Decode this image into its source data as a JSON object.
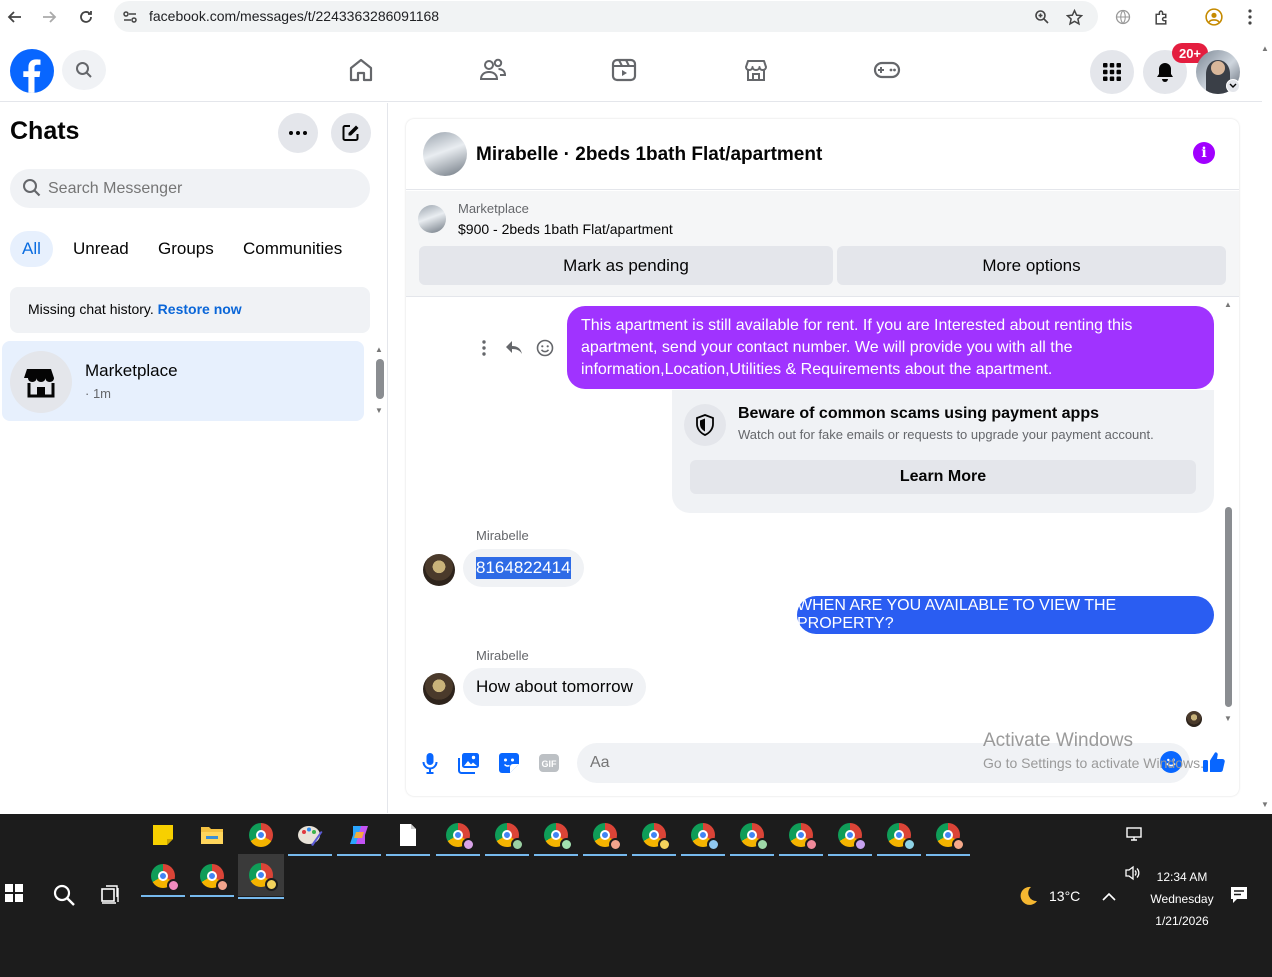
{
  "browser": {
    "url": "facebook.com/messages/t/2243363286091168"
  },
  "header": {
    "notifications_badge": "20+"
  },
  "sidebar": {
    "title": "Chats",
    "search_placeholder": "Search Messenger",
    "filters": [
      "All",
      "Unread",
      "Groups",
      "Communities"
    ],
    "missing_history_text": "Missing chat history.",
    "restore_link": "Restore now",
    "chat_item": {
      "name": "Marketplace",
      "time": "· 1m"
    }
  },
  "conversation": {
    "title": "Mirabelle · 2beds 1bath Flat/apartment",
    "marketplace_label": "Marketplace",
    "listing": "$900 - 2beds 1bath Flat/apartment",
    "mark_pending_label": "Mark as pending",
    "more_options_label": "More options",
    "messages": {
      "outgoing_1": "This apartment is still available for rent. If you are Interested about renting this apartment, send your contact number. We will provide you with all the information,Location,Utilities & Requirements about the apartment.",
      "scam_title": "Beware of common scams using payment apps",
      "scam_desc": "Watch out for fake emails or requests to upgrade your payment account.",
      "learn_more": "Learn More",
      "sender_name": "Mirabelle",
      "incoming_1": "8164822414",
      "outgoing_2": "WHEN ARE YOU AVAILABLE TO VIEW THE PROPERTY?",
      "incoming_2": "How about tomorrow"
    },
    "composer_placeholder": "Aa"
  },
  "watermark": {
    "title": "Activate Windows",
    "subtitle": "Go to Settings to activate Windows."
  },
  "taskbar": {
    "temperature": "13°C",
    "time": "12:34 AM",
    "day": "Wednesday",
    "date": "1/21/2026"
  },
  "colors": {
    "facebook_blue": "#0866ff",
    "outgoing_purple": "#a033ff",
    "outgoing_blue": "#2a5df2",
    "active_filter_bg": "#e7f0fd"
  }
}
